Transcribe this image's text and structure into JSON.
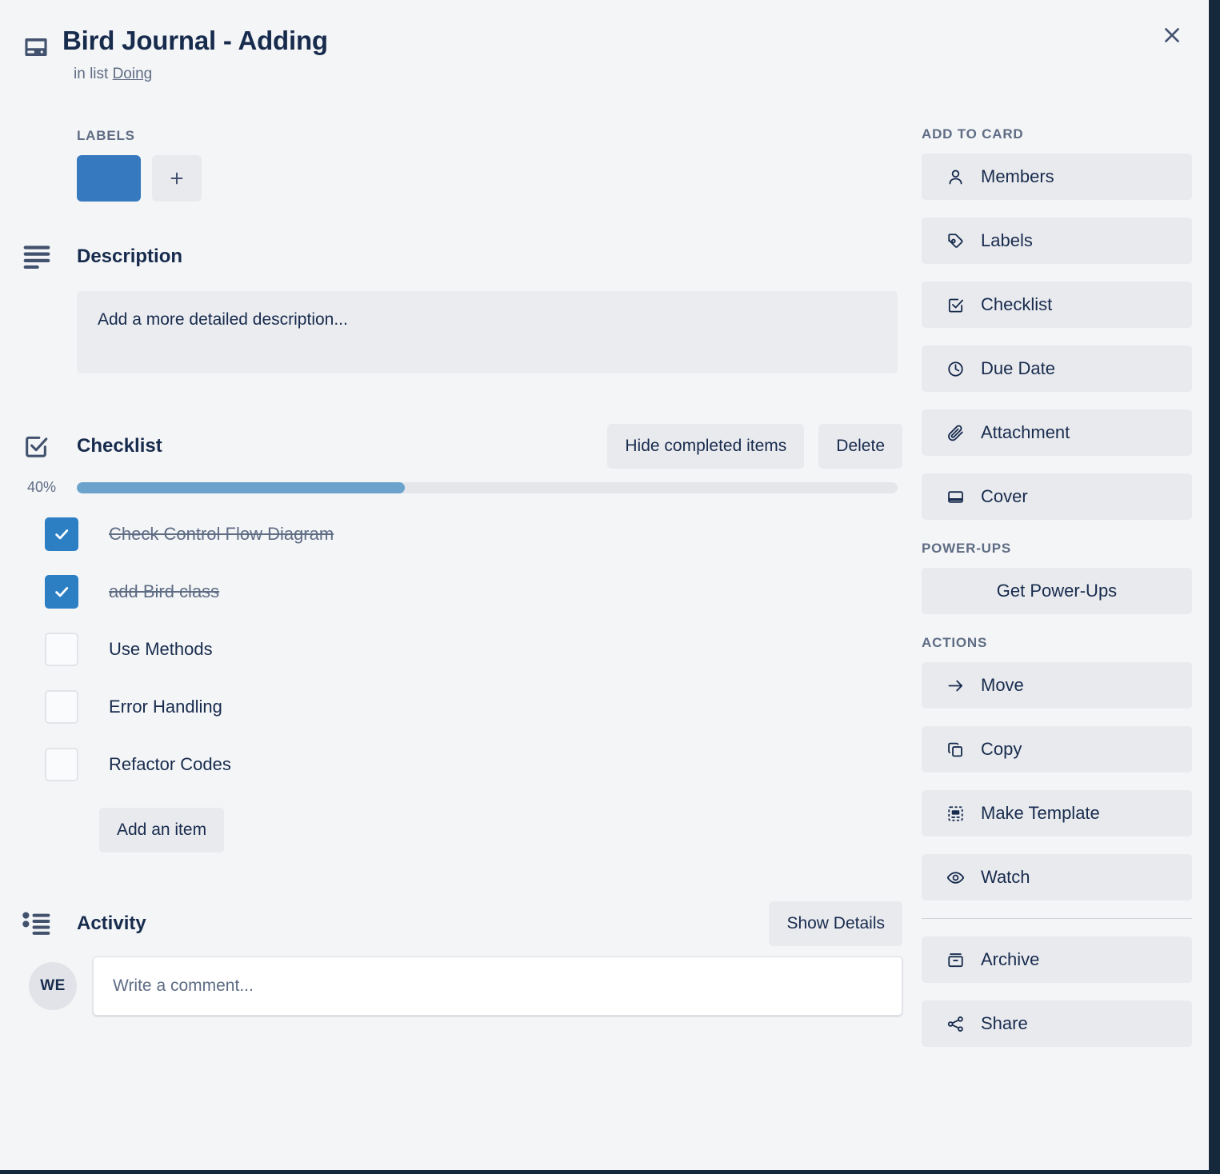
{
  "window": {
    "close_label": "Close",
    "close_icon": "close-icon",
    "edge_color": "#15283c"
  },
  "header": {
    "card_icon": "card-icon",
    "title": "Bird Journal - Adding",
    "in_list_prefix": "in list ",
    "list_name": "Doing"
  },
  "labels": {
    "heading": "LABELS",
    "chips": [
      {
        "name": "blue-label",
        "color": "#3679bf"
      }
    ],
    "add_label_icon": "plus-icon",
    "add_label_title": "Add label"
  },
  "description": {
    "icon": "description-lines-icon",
    "heading": "Description",
    "placeholder": "Add a more detailed description..."
  },
  "checklist": {
    "icon": "checklist-icon",
    "heading": "Checklist",
    "hide_completed_label": "Hide completed items",
    "delete_label": "Delete",
    "progress_percent_label": "40%",
    "progress_percent_value": 40,
    "progress_fill_color": "#6ba3cc",
    "progress_track_color": "#e4e6ea",
    "items": [
      {
        "label": "Check Control Flow Diagram",
        "checked": true
      },
      {
        "label": "add Bird class",
        "checked": true
      },
      {
        "label": "Use Methods",
        "checked": false
      },
      {
        "label": "Error Handling",
        "checked": false
      },
      {
        "label": "Refactor Codes",
        "checked": false
      }
    ],
    "add_item_label": "Add an item"
  },
  "activity": {
    "icon": "activity-list-icon",
    "heading": "Activity",
    "show_details_label": "Show Details",
    "avatar_initials": "WE",
    "comment_placeholder": "Write a comment...",
    "comment_value": ""
  },
  "sidebar": {
    "add_to_card": {
      "title": "ADD TO CARD",
      "items": [
        {
          "label": "Members",
          "icon": "person-icon"
        },
        {
          "label": "Labels",
          "icon": "tag-icon"
        },
        {
          "label": "Checklist",
          "icon": "checkbox-check-icon"
        },
        {
          "label": "Due Date",
          "icon": "clock-icon"
        },
        {
          "label": "Attachment",
          "icon": "paperclip-icon"
        },
        {
          "label": "Cover",
          "icon": "cover-icon"
        }
      ]
    },
    "power_ups": {
      "title": "POWER-UPS",
      "items": [
        {
          "label": "Get Power-Ups",
          "icon": ""
        }
      ]
    },
    "actions": {
      "title": "ACTIONS",
      "items": [
        {
          "label": "Move",
          "icon": "arrow-right-icon"
        },
        {
          "label": "Copy",
          "icon": "copy-icon"
        },
        {
          "label": "Make Template",
          "icon": "template-icon"
        },
        {
          "label": "Watch",
          "icon": "eye-icon"
        }
      ],
      "secondary_items": [
        {
          "label": "Archive",
          "icon": "archive-icon"
        },
        {
          "label": "Share",
          "icon": "share-icon"
        }
      ]
    }
  }
}
